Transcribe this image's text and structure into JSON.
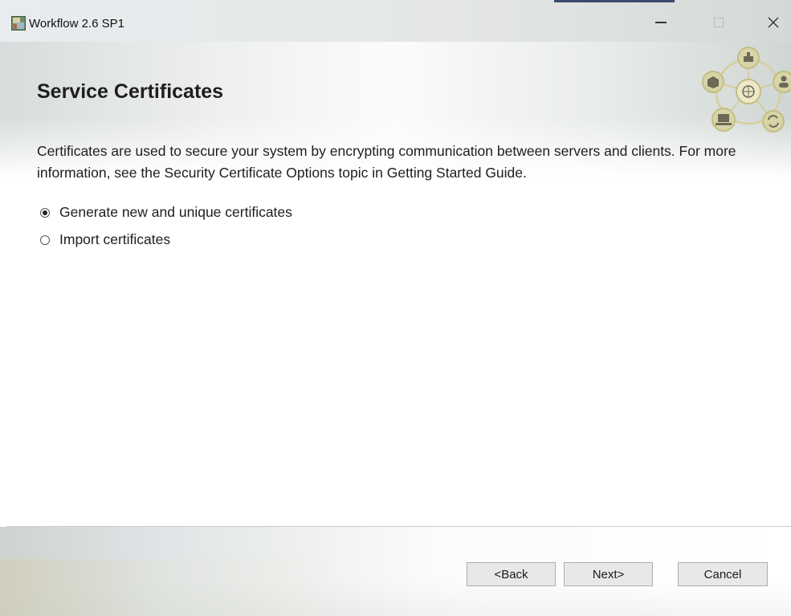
{
  "window": {
    "title": "Workflow 2.6 SP1",
    "controls": {
      "minimize_icon": "minimize-icon",
      "maximize_icon": "maximize-icon",
      "close_icon": "close-icon",
      "close_glyph": "✕"
    }
  },
  "header": {
    "title": "Service Certificates",
    "emblem_icon": "workflow-emblem-icon"
  },
  "main": {
    "description": "Certificates are used to secure your system by encrypting communication between servers and clients. For more information, see the Security Certificate Options topic in Getting Started Guide.",
    "options": [
      {
        "label": "Generate new and unique certificates",
        "selected": true
      },
      {
        "label": "Import certificates",
        "selected": false
      }
    ]
  },
  "footer": {
    "back_label": "<Back",
    "next_label": "Next>",
    "cancel_label": "Cancel"
  },
  "colors": {
    "title_bar": "#e6e9e8",
    "emblem_fill": "#d8d4a8",
    "emblem_stroke": "#c4bd82",
    "emblem_glyph": "#6a6a55",
    "button_face": "#e8e8e8",
    "button_border": "#adadad"
  }
}
